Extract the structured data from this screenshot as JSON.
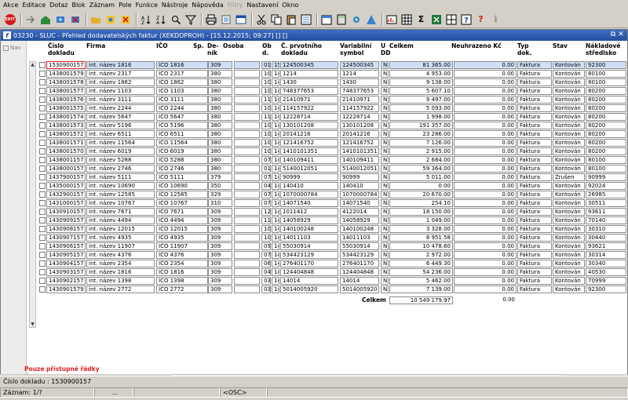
{
  "menu": [
    "Akce",
    "Editace",
    "Dotaz",
    "Blok",
    "Záznam",
    "Pole",
    "Funkce",
    "Nástroje",
    "Nápověda",
    "Filtry",
    "Nastavení",
    "Okno"
  ],
  "window": {
    "title": "03230 - SLUC - Přehled dodavatelských faktur (XEKDOPROH) - [15.12.2015; 09:27] [] []"
  },
  "nav_label": "Nav",
  "headers": {
    "doc": "Číslo\ndokladu",
    "firm": "Firma",
    "ico": "IČO",
    "sp": "Sp.",
    "denik": "De-\nník",
    "osoba": "Osoba",
    "obd": "Ob\nd.",
    "cprv": "Č. prvotního\ndokladu",
    "vs": "Variabilní\nsymbol",
    "udd": "U\nDD",
    "celkem": "Celkem",
    "neuhr": "Neuhrazeno Kč",
    "typ": "Typ\ndok.",
    "stav": "Stav",
    "nakl": "Nákladové\nstředisko"
  },
  "rows": [
    [
      "1530900157",
      "int. název 1816",
      "IČO 1816",
      "309",
      "01",
      "15",
      "124500345",
      "124500345",
      "N",
      "81 365.00",
      "0.00",
      "Faktura",
      "Kontován",
      "92300"
    ],
    [
      "1438001579",
      "int. název 2317",
      "IČO 2317",
      "380",
      "10",
      "14",
      "1214",
      "1214",
      "N",
      "4 953.00",
      "0.00",
      "Faktura",
      "Kontován",
      "80100"
    ],
    [
      "1438001578",
      "int. název 1862",
      "IČO 1862",
      "380",
      "10",
      "14",
      "1430",
      "1430",
      "N",
      "9 138.00",
      "0.00",
      "Faktura",
      "Kontován",
      "80100"
    ],
    [
      "1438001577",
      "int. název 1103",
      "IČO 1103",
      "380",
      "10",
      "14",
      "748377653",
      "748377653",
      "N",
      "5 607.10",
      "0.00",
      "Faktura",
      "Kontován",
      "80200"
    ],
    [
      "1438001576",
      "int. název 3111",
      "IČO 3111",
      "380",
      "11",
      "14",
      "21410971",
      "21410971",
      "N",
      "9 497.00",
      "0.00",
      "Faktura",
      "Kontován",
      "80200"
    ],
    [
      "1438001575",
      "int. název 2244",
      "IČO 2244",
      "380",
      "10",
      "14",
      "114157922",
      "114157922",
      "N",
      "5 093.00",
      "0.00",
      "Faktura",
      "Kontován",
      "80200"
    ],
    [
      "1438001574",
      "int. název 5647",
      "IČO 5647",
      "380",
      "11",
      "14",
      "12228714",
      "12228714",
      "N",
      "1 998.00",
      "0.00",
      "Faktura",
      "Kontován",
      "80200"
    ],
    [
      "1438001573",
      "int. název 5196",
      "IČO 5196",
      "380",
      "10",
      "14",
      "130101208",
      "130101208",
      "N",
      "191 357.00",
      "0.00",
      "Faktura",
      "Kontován",
      "80200"
    ],
    [
      "1438001572",
      "int. název 6511",
      "IČO 6511",
      "380",
      "10",
      "14",
      "20141216",
      "20141216",
      "N",
      "23 286.00",
      "0.00",
      "Faktura",
      "Kontován",
      "80200"
    ],
    [
      "1438001571",
      "int. název 11564",
      "IČO 11564",
      "380",
      "10",
      "14",
      "121416752",
      "121416752",
      "N",
      "7 126.00",
      "0.00",
      "Faktura",
      "Kontován",
      "80200"
    ],
    [
      "1438001570",
      "int. název 6019",
      "IČO 6019",
      "380",
      "10",
      "14",
      "1410101351",
      "1410101351",
      "N",
      "2 915.00",
      "0.00",
      "Faktura",
      "Kontován",
      "80200"
    ],
    [
      "1438001157",
      "int. název 5288",
      "IČO 5288",
      "380",
      "07",
      "14",
      "140109411",
      "140109411",
      "N",
      "2 684.00",
      "0.00",
      "Faktura",
      "Kontován",
      "80100"
    ],
    [
      "1438000157",
      "int. název 2746",
      "IČO 2746",
      "380",
      "01",
      "14",
      "5140012051",
      "5140012051",
      "N",
      "59 364.00",
      "0.00",
      "Faktura",
      "Kontován",
      "80100"
    ],
    [
      "1437900157",
      "int. název 5111",
      "IČO 5111",
      "379",
      "07",
      "14",
      "90999",
      "90999",
      "N",
      "5 011.00",
      "0.00",
      "Faktura",
      "Zrušen",
      "90999"
    ],
    [
      "1435000157",
      "int. název 10690",
      "IČO 10690",
      "350",
      "04",
      "14",
      "140410",
      "140410",
      "N",
      "0.00",
      "0.00",
      "Faktura",
      "Kontován",
      "92024"
    ],
    [
      "1432900157",
      "int. název 12585",
      "IČO 12585",
      "329",
      "07",
      "14",
      "1070000784",
      "1070000784",
      "N",
      "20 670.00",
      "0.00",
      "Faktura",
      "Kontován",
      "26985"
    ],
    [
      "1431000157",
      "int. název 10767",
      "IČO 10767",
      "310",
      "07",
      "14",
      "14071540",
      "14071540",
      "N",
      "254.10",
      "0.00",
      "Faktura",
      "Kontován",
      "30511"
    ],
    [
      "1430910157",
      "int. název 7671",
      "IČO 7671",
      "309",
      "12",
      "14",
      "1011412",
      "4122014",
      "N",
      "18 150.00",
      "0.00",
      "Faktura",
      "Kontován",
      "93611"
    ],
    [
      "1430909157",
      "int. název 4494",
      "IČO 4494",
      "309",
      "11",
      "14",
      "14058929",
      "14058929",
      "N",
      "1 049.00",
      "0.00",
      "Faktura",
      "Kontován",
      "70140"
    ],
    [
      "1430908157",
      "int. název 12015",
      "IČO 12015",
      "309",
      "10",
      "14",
      "140100248",
      "140100248",
      "N",
      "3 328.00",
      "0.00",
      "Faktura",
      "Kontován",
      "30310"
    ],
    [
      "1430907157",
      "int. název 4935",
      "IČO 4935",
      "309",
      "10",
      "14",
      "14011103",
      "14011103",
      "N",
      "8 951.58",
      "0.00",
      "Faktura",
      "Kontován",
      "30440"
    ],
    [
      "1430906157",
      "int. název 11907",
      "IČO 11907",
      "309",
      "09",
      "14",
      "55030914",
      "55030914",
      "N",
      "10 478.60",
      "0.00",
      "Faktura",
      "Kontován",
      "93621"
    ],
    [
      "1430905157",
      "int. název 4376",
      "IČO 4376",
      "309",
      "07",
      "14",
      "534423129",
      "534423129",
      "N",
      "2 972.00",
      "0.00",
      "Faktura",
      "Kontován",
      "30314"
    ],
    [
      "1430904157",
      "int. název 2354",
      "IČO 2354",
      "309",
      "06",
      "14",
      "276401170",
      "276401170",
      "N",
      "6 449.30",
      "0.00",
      "Faktura",
      "Kontován",
      "30340"
    ],
    [
      "1430903157",
      "int. název 1816",
      "IČO 1816",
      "309",
      "04",
      "14",
      "124404848",
      "124404848",
      "N",
      "54 236.00",
      "0.00",
      "Faktura",
      "Kontován",
      "40530"
    ],
    [
      "1430902157",
      "int. název 1398",
      "IČO 1398",
      "309",
      "03",
      "14",
      "14014",
      "14014",
      "N",
      "5 462.00",
      "0.00",
      "Faktura",
      "Kontován",
      "70999"
    ],
    [
      "1430901579",
      "int. název 2772",
      "IČO 2772",
      "309",
      "03",
      "14",
      "5014005920",
      "5014005920",
      "N",
      "7 139.00",
      "0.00",
      "Faktura",
      "Kontován",
      "92300"
    ]
  ],
  "total": {
    "label": "Celkem",
    "sum": "10 549 179.97",
    "unpaid": "0.00"
  },
  "note": "Pouze přístupné řádky",
  "status": {
    "doc": "Číslo dokladu : 1530900157",
    "record": "Záznam: 1/?",
    "dots": "...",
    "osc": "<OSC>"
  },
  "colors": {
    "titlebar": "#244f9e",
    "selected_row": "#cfe0f6",
    "note": "#e02020"
  },
  "toolbar_icons": [
    "exit-icon",
    "scissors-icon",
    "copy-icon",
    "paste-icon",
    "save-icon",
    "print-icon",
    "sort-asc-icon",
    "sort-desc-icon",
    "filter-icon",
    "search-icon",
    "calendar-icon",
    "help-icon",
    "info-icon"
  ]
}
